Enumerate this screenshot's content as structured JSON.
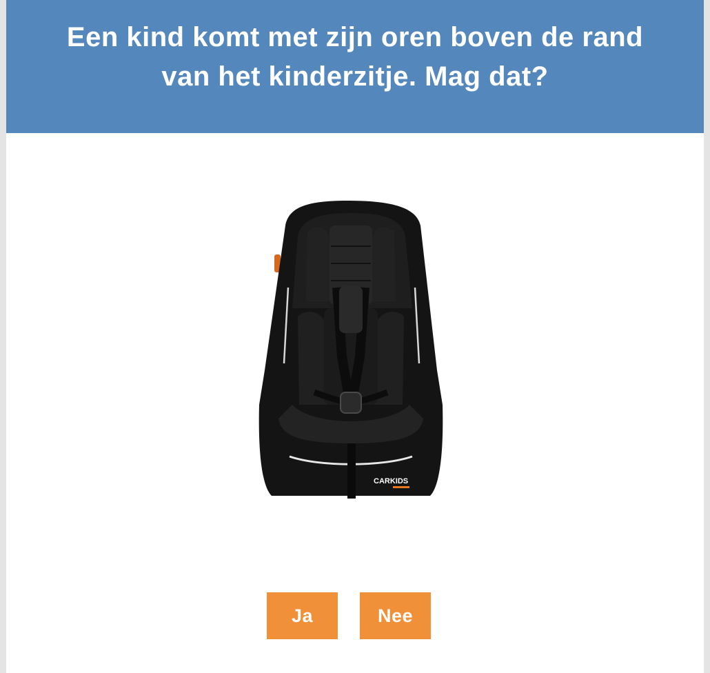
{
  "question": {
    "title": "Een kind komt met zijn oren boven de rand van het kinderzitje. Mag dat?"
  },
  "image": {
    "icon": "car-seat-icon",
    "logo_text": "CARKIDS"
  },
  "answers": [
    {
      "label": "Ja"
    },
    {
      "label": "Nee"
    }
  ],
  "colors": {
    "header_bg": "#5487bb",
    "button_bg": "#f0913a",
    "seat_black": "#161616",
    "logo_orange": "#e8781e"
  }
}
